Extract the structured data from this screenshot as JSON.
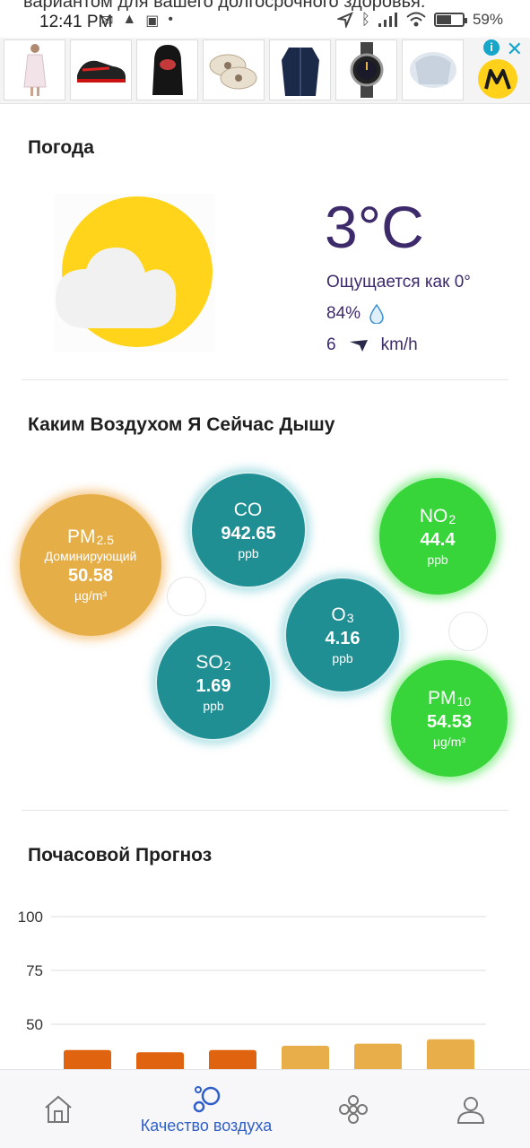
{
  "status_bar": {
    "marquee": "вариантом для вашего долгосрочного здоровья.",
    "time": "12:41 PM",
    "battery": "59%",
    "battery_level": 0.59
  },
  "ad": {
    "info_label": "i",
    "close_label": "✕",
    "thumbnails": [
      "dress",
      "sneaker",
      "balaclava",
      "slippers",
      "jacket",
      "watch",
      "clothes"
    ]
  },
  "weather": {
    "title": "Погода",
    "temperature": "3°C",
    "feels_like": "Ощущается как 0°",
    "humidity": "84%",
    "wind_speed": "6",
    "wind_unit": "km/h",
    "icon": "partly-cloudy-icon"
  },
  "air": {
    "title": "Каким Воздухом Я Сейчас Дышу",
    "pollutants": {
      "pm25": {
        "name": "PM",
        "sub": "2.5",
        "note": "Доминирующий",
        "value": "50.58",
        "unit": "µg/m³",
        "color": "#e5ae47"
      },
      "co": {
        "name": "CO",
        "sub": "",
        "value": "942.65",
        "unit": "ppb",
        "color": "#1f8f93"
      },
      "no2": {
        "name": "NO",
        "sub": "2",
        "value": "44.4",
        "unit": "ppb",
        "color": "#37d43a"
      },
      "o3": {
        "name": "O",
        "sub": "3",
        "value": "4.16",
        "unit": "ppb",
        "color": "#1f8f93"
      },
      "so2": {
        "name": "SO",
        "sub": "2",
        "value": "1.69",
        "unit": "ppb",
        "color": "#1f8f93"
      },
      "pm10": {
        "name": "PM",
        "sub": "10",
        "value": "54.53",
        "unit": "µg/m³",
        "color": "#37d43a"
      }
    }
  },
  "forecast": {
    "title": "Почасовой Прогноз"
  },
  "chart_data": {
    "type": "bar",
    "title": "",
    "xlabel": "",
    "ylabel": "",
    "yticks": [
      100,
      75,
      50
    ],
    "ylim": [
      25,
      100
    ],
    "grid": true,
    "categories": [
      "",
      "",
      "",
      "",
      "",
      ""
    ],
    "values": [
      38,
      37,
      38,
      40,
      41,
      43
    ],
    "colors": [
      "#e0640f",
      "#e0640f",
      "#e0640f",
      "#e7ae4a",
      "#e7ae4a",
      "#e7ae4a"
    ]
  },
  "nav": {
    "home_icon": "home-icon",
    "air_label": "Качество воздуха",
    "air_icon": "bubbles-icon",
    "pollen_icon": "flower-icon",
    "profile_icon": "user-icon"
  }
}
